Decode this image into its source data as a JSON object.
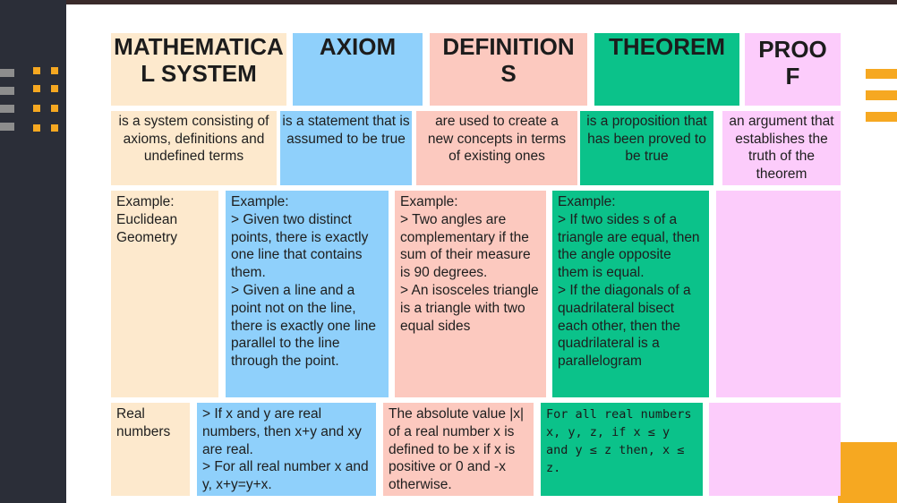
{
  "columns": [
    {
      "key": "math",
      "title": "MATHEMATICA\nL SYSTEM",
      "definition": "is a system consisting of axioms, definitions and undefined terms",
      "example": "Example:\nEuclidean Geometry",
      "example2": "Real numbers"
    },
    {
      "key": "axiom",
      "title": "AXIOM",
      "definition": "is a statement that is assumed to be true",
      "example": "Example:\n> Given two distinct points, there is exactly one line that contains them.\n> Given a line and a point not on the line, there is exactly one line parallel to the line through the point.",
      "example2": "> If x and y are real numbers, then x+y and xy are real.\n> For all real number x and y, x+y=y+x."
    },
    {
      "key": "definition",
      "title": "DEFINITION\nS",
      "definition": "are used to create a new concepts in terms of existing ones",
      "example": "Example:\n> Two angles are complementary if the sum of their measure is 90 degrees.\n> An isosceles triangle is a triangle with two equal sides",
      "example2": "The absolute value |x| of a real number x is defined to be x if x is positive or 0 and -x otherwise."
    },
    {
      "key": "theorem",
      "title": "THEOREM",
      "definition": "is a  proposition that has been proved to be true",
      "example": "Example:\n> If two sides s of a triangle are equal, then the angle opposite them is equal.\n> If the diagonals of a quadrilateral bisect each other, then the quadrilateral is a parallelogram",
      "example2": "For all real numbers x, y, z, if x ≤ y and y ≤ z then, x ≤ z."
    },
    {
      "key": "proof",
      "title": "PROO\nF",
      "definition": "an argument that establishes the truth of the theorem",
      "example": "",
      "example2": ""
    }
  ],
  "colors": {
    "beige": "#fde9cd",
    "blue": "#8fd0fb",
    "pink": "#fcc9bf",
    "green": "#0bc28a",
    "lavender": "#fcccfb",
    "accent_orange": "#f6a821",
    "sidebar": "#2b2e38"
  }
}
